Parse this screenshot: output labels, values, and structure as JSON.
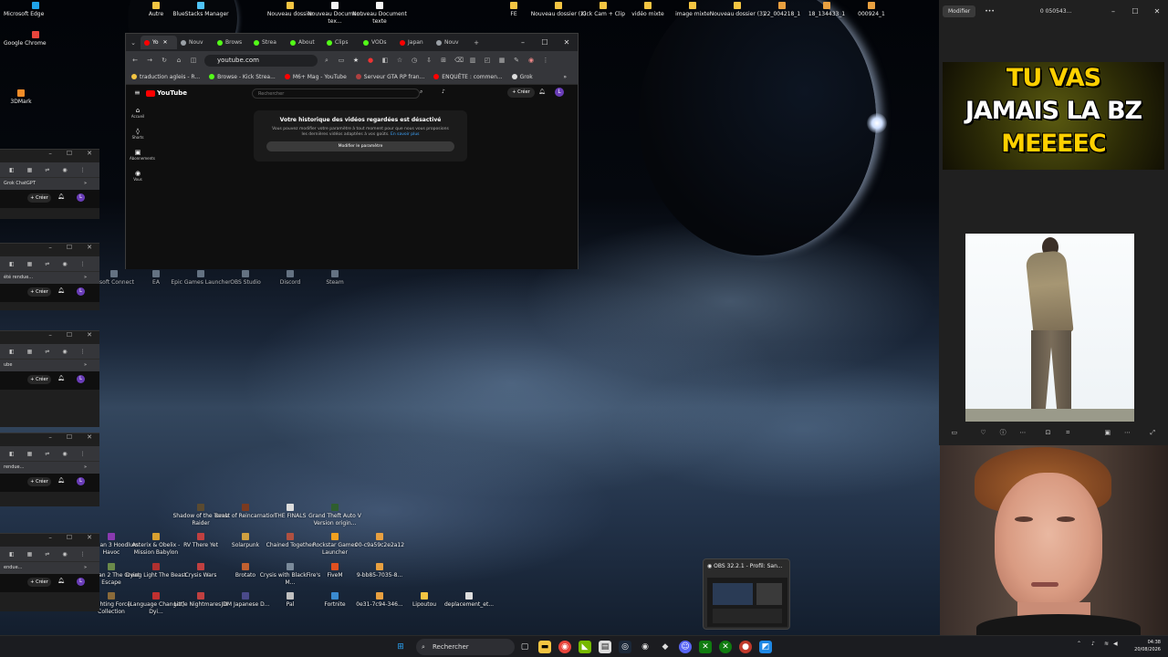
{
  "desktop": {
    "icons_top": [
      {
        "label": "Microsoft Edge",
        "color": "#1fa3e8"
      },
      {
        "label": "Google Chrome",
        "color": "#e8453c"
      },
      {
        "label": "3DMark",
        "color": "#f28c28"
      },
      {
        "label": "Autre",
        "color": "#f4c542"
      },
      {
        "label": "BlueStacks Manager",
        "color": "#4fc3f7"
      },
      {
        "label": "Nouveau dossier",
        "color": "#f4c542"
      },
      {
        "label": "Nouveau Document tex...",
        "color": "#f5f5f5"
      },
      {
        "label": "Nouveau Document texte",
        "color": "#f5f5f5"
      },
      {
        "label": "FE",
        "color": "#f4c542"
      },
      {
        "label": "Nouveau dossier (2)",
        "color": "#f4c542"
      },
      {
        "label": "Kick Cam + Clip",
        "color": "#f4c542"
      },
      {
        "label": "vidéo mixte",
        "color": "#f4c542"
      },
      {
        "label": "image mixte",
        "color": "#f4c542"
      },
      {
        "label": "Nouveau dossier (3)",
        "color": "#f4c542"
      },
      {
        "label": "22_004218_1",
        "color": "#e8a040"
      },
      {
        "label": "18_134433_1",
        "color": "#e8a040"
      },
      {
        "label": "000924_1",
        "color": "#e8a040"
      }
    ],
    "icons_mid": [
      {
        "label": "rosoft Connect"
      },
      {
        "label": "EA"
      },
      {
        "label": "Epic Games Launcher"
      },
      {
        "label": "OBS Studio"
      },
      {
        "label": "Discord"
      },
      {
        "label": "Steam"
      }
    ],
    "icons_bottom": [
      {
        "label": "Shadow of the Tomb Raider"
      },
      {
        "label": "Beast of Reincarnation"
      },
      {
        "label": "THE FINALS"
      },
      {
        "label": "Grand Theft Auto V Version origin..."
      },
      {
        "label": "Rayman 3 Hoodlum Havoc"
      },
      {
        "label": "Asterix & Obelix - Mission Babylon"
      },
      {
        "label": "RV There Yet"
      },
      {
        "label": "Solarpunk"
      },
      {
        "label": "Chained Together"
      },
      {
        "label": "Rockstar Games Launcher"
      },
      {
        "label": "00-c9a59c2e2a12"
      },
      {
        "label": "Rayman 2 The Great Escape"
      },
      {
        "label": "Dying Light The Beast"
      },
      {
        "label": "Crysis Wars"
      },
      {
        "label": "Brotato"
      },
      {
        "label": "Crysis with BlackFire's M..."
      },
      {
        "label": "FiveM"
      },
      {
        "label": "9-bb85-7035-8..."
      },
      {
        "label": "Fighting Force Collection"
      },
      {
        "label": "[Language Changer] Dyi..."
      },
      {
        "label": "Little Nightmares III"
      },
      {
        "label": "JDM Japanese D..."
      },
      {
        "label": "Pal"
      },
      {
        "label": "Fortnite"
      },
      {
        "label": "0e31-7c94-346..."
      },
      {
        "label": "Lipoutou"
      },
      {
        "label": "deplacement_et..."
      }
    ]
  },
  "browser": {
    "tabs": [
      {
        "label": "Yo",
        "fav": "#ff0000"
      },
      {
        "label": "Nouv",
        "fav": "#9aa0a6"
      },
      {
        "label": "Brows",
        "fav": "#53fc18"
      },
      {
        "label": "Strea",
        "fav": "#53fc18"
      },
      {
        "label": "About",
        "fav": "#53fc18"
      },
      {
        "label": "Clips",
        "fav": "#53fc18"
      },
      {
        "label": "VODs",
        "fav": "#53fc18"
      },
      {
        "label": "Japan",
        "fav": "#ff0000"
      },
      {
        "label": "Nouv",
        "fav": "#9aa0a6"
      }
    ],
    "new_tab": "+",
    "url": "youtube.com",
    "bookmarks": [
      {
        "label": "traduction agleis - R...",
        "fav": "#f4c542"
      },
      {
        "label": "Browse - Kick Strea...",
        "fav": "#53fc18"
      },
      {
        "label": "M6+ Mag - YouTube",
        "fav": "#ff0000"
      },
      {
        "label": "Serveur GTA RP fran...",
        "fav": "#b04040"
      },
      {
        "label": "ENQUÊTE : commen...",
        "fav": "#ff0000"
      },
      {
        "label": "Grok",
        "fav": "#dddddd"
      }
    ]
  },
  "youtube": {
    "logo": "YouTube",
    "search_placeholder": "Rechercher",
    "create": "Créer",
    "avatar": "L",
    "nav": [
      {
        "icon": "⌂",
        "label": "Accueil"
      },
      {
        "icon": "◊",
        "label": "Shorts"
      },
      {
        "icon": "▣",
        "label": "Abonnements"
      },
      {
        "icon": "◉",
        "label": "Vous"
      }
    ],
    "notice_title": "Votre historique des vidéos regardées est désactivé",
    "notice_body": "Vous pouvez modifier votre paramètre à tout moment pour que nous vous proposions les dernières vidéos adaptées à vos goûts.",
    "notice_link": "En savoir plus",
    "notice_button": "Modifier le paramètre"
  },
  "left_stack": [
    {
      "row2_left": "Grok   ChatGPT",
      "row2_right": "»",
      "create": "Créer",
      "avatar": "L"
    },
    {
      "row2_left": "été rendue...",
      "row2_right": "»",
      "create": "Créer",
      "avatar": "L"
    },
    {
      "row2_left": "ube",
      "row2_right": "»",
      "create": "Créer",
      "avatar": "L"
    },
    {
      "row2_left": "rendue...",
      "row2_right": "»",
      "create": "Créer",
      "avatar": "L"
    },
    {
      "row2_left": "endue...",
      "row2_right": "»",
      "create": "Créer",
      "avatar": "L"
    }
  ],
  "viewer": {
    "edit_label": "Modifier",
    "file_name": "0 050543...",
    "thumb_lines": [
      "TU VAS",
      "JAMAIS LA BZ",
      "MEEEEC"
    ]
  },
  "obs": {
    "title": "OBS 32.2.1 - Profil: San..."
  },
  "taskbar": {
    "search_label": "Rechercher",
    "time": "04:38",
    "date": "20/08/2026"
  }
}
